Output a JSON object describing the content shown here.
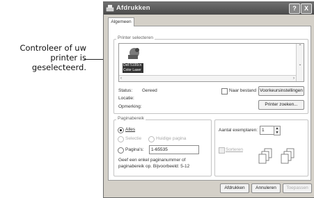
{
  "callout": {
    "line1": "Controleer of uw",
    "line2": "printer is",
    "line3": "geselecteerd."
  },
  "window": {
    "title": "Afdrukken",
    "help_glyph": "?",
    "close_glyph": "X",
    "tab": "Algemeen"
  },
  "printer_group": {
    "label": "Printer selecteren",
    "printer_name_line1": "Dell 5100cn",
    "printer_name_line2": "Color Laser",
    "status_label": "Status:",
    "status_value": "Gereed",
    "location_label": "Locatie:",
    "comment_label": "Opmerking:",
    "print_to_file": "Naar bestand",
    "preferences_button": "Voorkeursinstellingen",
    "find_printer_button": "Printer zoeken..."
  },
  "page_range": {
    "label": "Paginabereik",
    "all": "Alles",
    "selection": "Selectie",
    "current_page": "Huidige pagina",
    "pages": "Pagina's:",
    "pages_value": "1-65535",
    "hint_line1": "Geef een enkel paginanummer of",
    "hint_line2": "paginabereik op. Bijvoorbeeld: 5-12"
  },
  "copies": {
    "label": "Aantal exemplaren:",
    "value": "1",
    "collate": "Sorteren"
  },
  "footer": {
    "print_button": "Afdrukken",
    "cancel_button": "Annuleren",
    "apply_button": "Toepassen"
  }
}
